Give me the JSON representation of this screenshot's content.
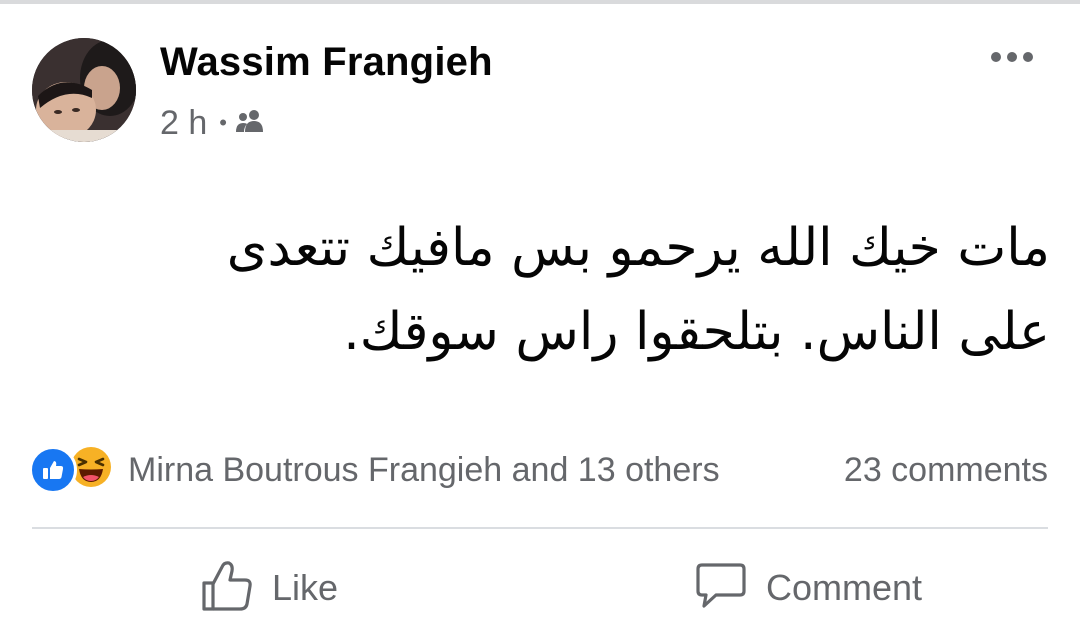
{
  "post": {
    "author": "Wassim Frangieh",
    "time": "2 h",
    "separator": "•",
    "audience_icon": "friends-icon",
    "text_line1": "مات خيك الله يرحمو بس مافيك تتعدى",
    "text_line2": "على الناس. بتلحقوا راس سوقك."
  },
  "reactions": {
    "icons": [
      "like-icon",
      "haha-icon"
    ],
    "summary": "Mirna Boutrous Frangieh and 13 others",
    "comments": "23 comments"
  },
  "actions": {
    "like_label": "Like",
    "comment_label": "Comment"
  },
  "colors": {
    "primary_text": "#050505",
    "secondary_text": "#65676b",
    "like_blue": "#1877f2",
    "haha_yellow": "#f7b125",
    "divider": "#dadde1"
  }
}
